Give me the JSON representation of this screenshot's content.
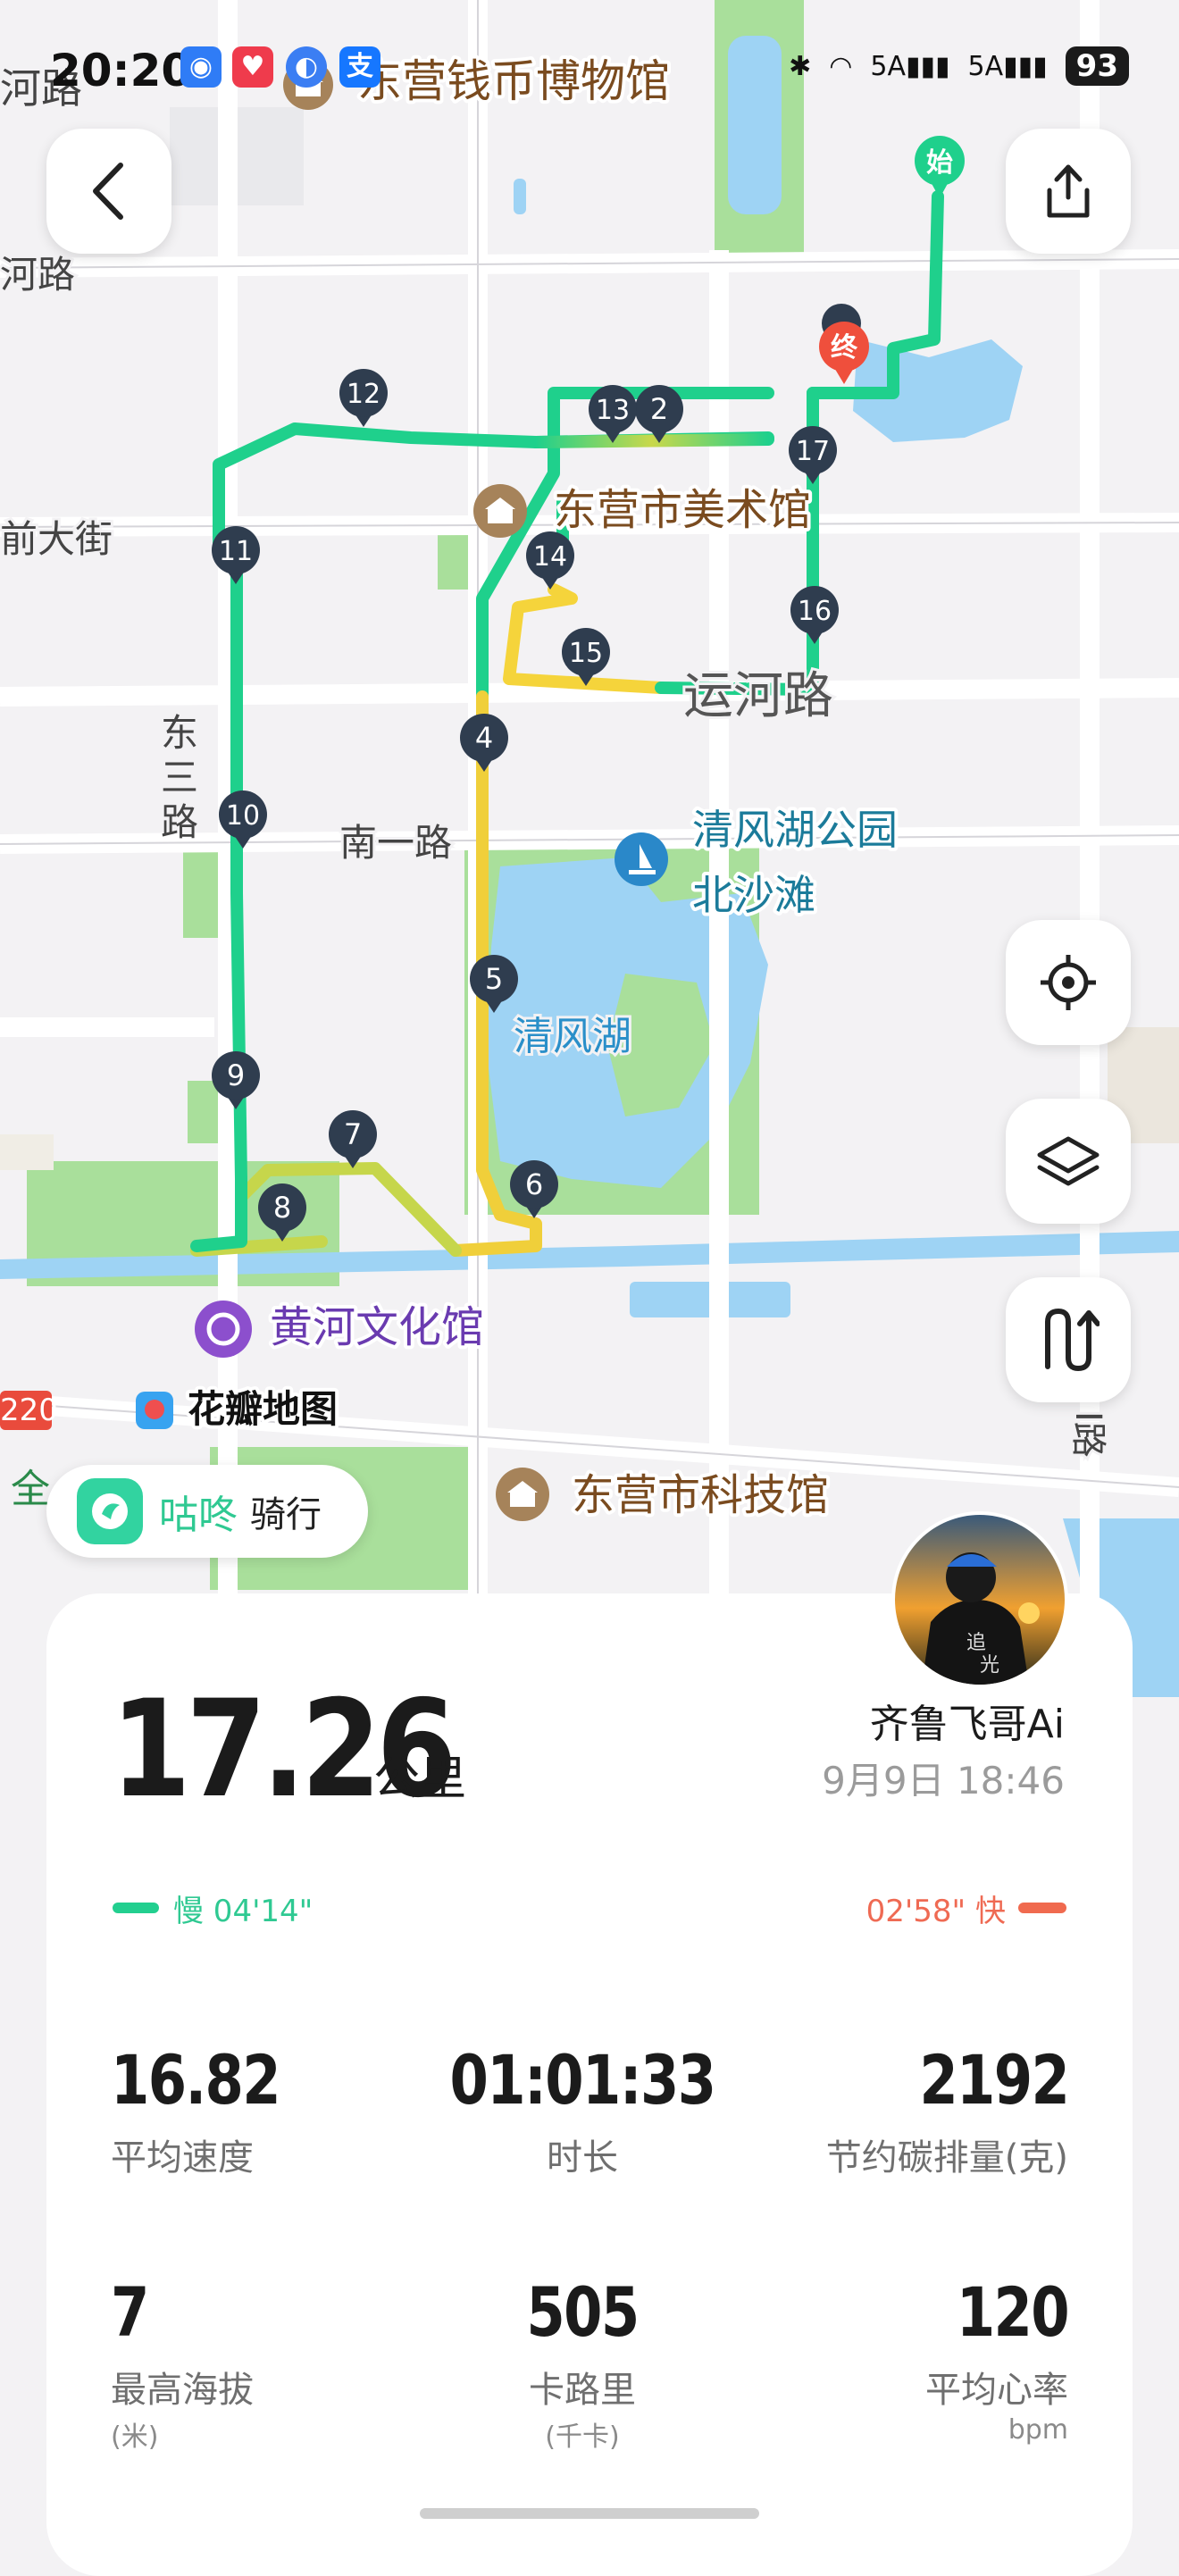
{
  "status_bar": {
    "time": "20:20",
    "battery": "93",
    "signal_1": "5A",
    "signal_2": "5A"
  },
  "map": {
    "poi_labels": [
      {
        "text": "东营钱币博物馆",
        "color": "#7a4b1f"
      },
      {
        "text": "东营市美术馆",
        "color": "#7a4b1f"
      },
      {
        "text": "清风湖公园",
        "color": "#1b7b9a"
      },
      {
        "text": "北沙滩",
        "color": "#1b7b9a"
      },
      {
        "text": "黄河文化馆",
        "color": "#6a3bb0"
      },
      {
        "text": "东营市科技馆",
        "color": "#7a4b1f"
      },
      {
        "text": "花瓣地图",
        "color": "#111111"
      }
    ],
    "road_labels": [
      "河路",
      "河路",
      "前大街",
      "东三路",
      "南一路",
      "运河路",
      "清风湖",
      "220",
      "I路",
      "全"
    ],
    "markers": [
      "2",
      "4",
      "5",
      "6",
      "7",
      "8",
      "9",
      "10",
      "11",
      "12",
      "13",
      "14",
      "15",
      "16",
      "17"
    ],
    "start_label": "始",
    "end_label": "终"
  },
  "brand": {
    "name": "咕咚",
    "subtitle": "骑行"
  },
  "summary": {
    "distance": "17.26",
    "distance_unit": "公里",
    "user_name": "齐鲁飞哥Ai",
    "date": "9月9日 18:46",
    "pace_slow": "慢 04'14\"",
    "pace_fast": "02'58\" 快"
  },
  "stats": [
    {
      "value": "16.82",
      "label": "平均速度",
      "unit": ""
    },
    {
      "value": "01:01:33",
      "label": "时长",
      "unit": ""
    },
    {
      "value": "2192",
      "label": "节约碳排量(克)",
      "unit": ""
    },
    {
      "value": "7",
      "label": "最高海拔",
      "unit": "(米)"
    },
    {
      "value": "505",
      "label": "卡路里",
      "unit": "(千卡)"
    },
    {
      "value": "120",
      "label": "平均心率",
      "unit": "bpm"
    }
  ],
  "colors": {
    "route_green": "#1fd08c",
    "route_yellow": "#f5d43b",
    "pace_slow": "#2fc992",
    "pace_fast": "#ef6a53"
  }
}
